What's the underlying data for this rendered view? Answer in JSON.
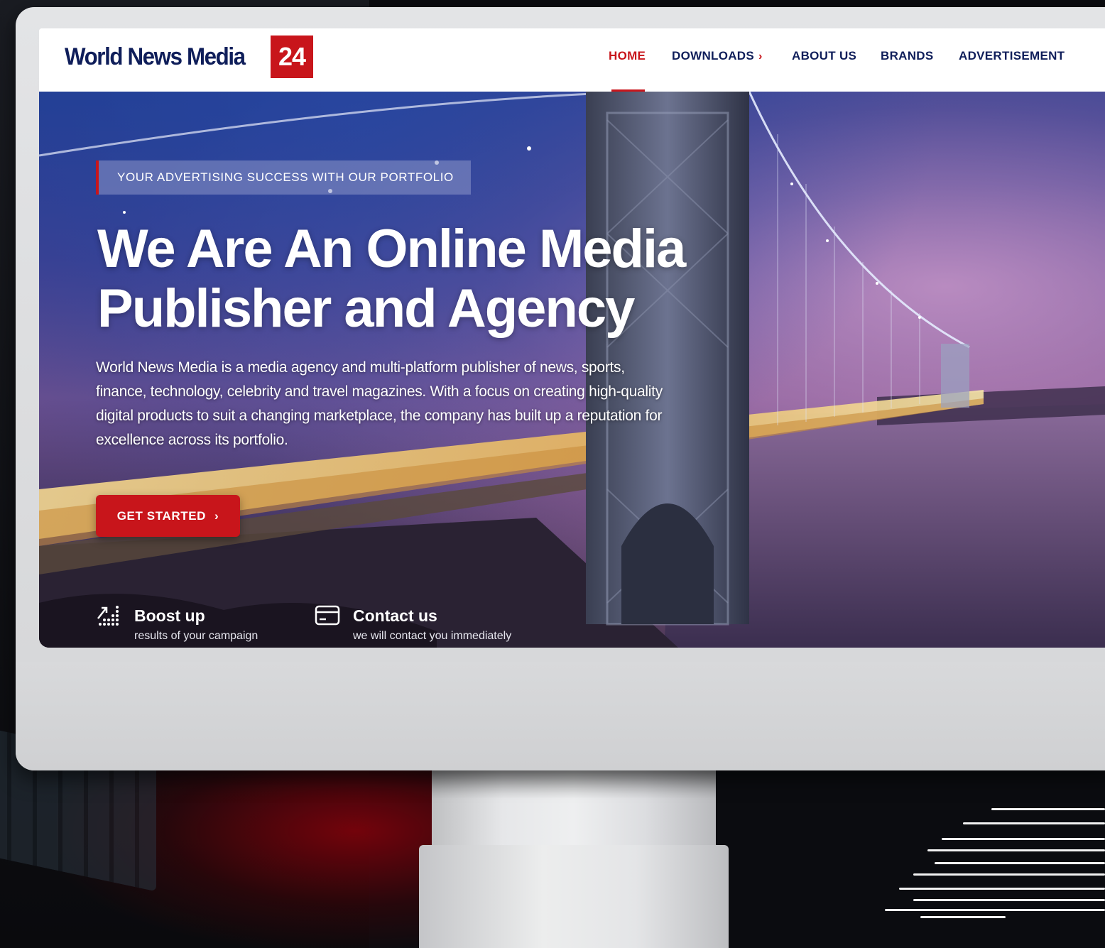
{
  "brand": {
    "name": "World News Media",
    "badge": "24",
    "badge_color": "#c8151b",
    "text_color": "#0f1e5a"
  },
  "nav": {
    "items": [
      {
        "label": "HOME",
        "active": true
      },
      {
        "label": "DOWNLOADS",
        "has_submenu": true,
        "chevron": "›"
      },
      {
        "label": "ABOUT US"
      },
      {
        "label": "BRANDS"
      },
      {
        "label": "ADVERTISEMENT"
      }
    ]
  },
  "hero": {
    "tagline": "YOUR ADVERTISING SUCCESS WITH OUR PORTFOLIO",
    "headline_line1": "We Are An Online Media",
    "headline_line2": "Publisher and Agency",
    "description": "World News Media is a media agency and multi-platform publisher of news, sports, finance, technology, celebrity and travel magazines. With a focus on creating high-quality digital products to suit a changing marketplace, the company has built up a reputation for excellence across its portfolio.",
    "cta_label": "GET STARTED",
    "cta_arrow": "›",
    "background_image": "suspension bridge at night"
  },
  "features": [
    {
      "icon": "chart-growth-icon",
      "title": "Boost up",
      "subtitle": "results of your campaign"
    },
    {
      "icon": "credit-card-icon",
      "title": "Contact us",
      "subtitle": "we will contact you immediately"
    }
  ]
}
